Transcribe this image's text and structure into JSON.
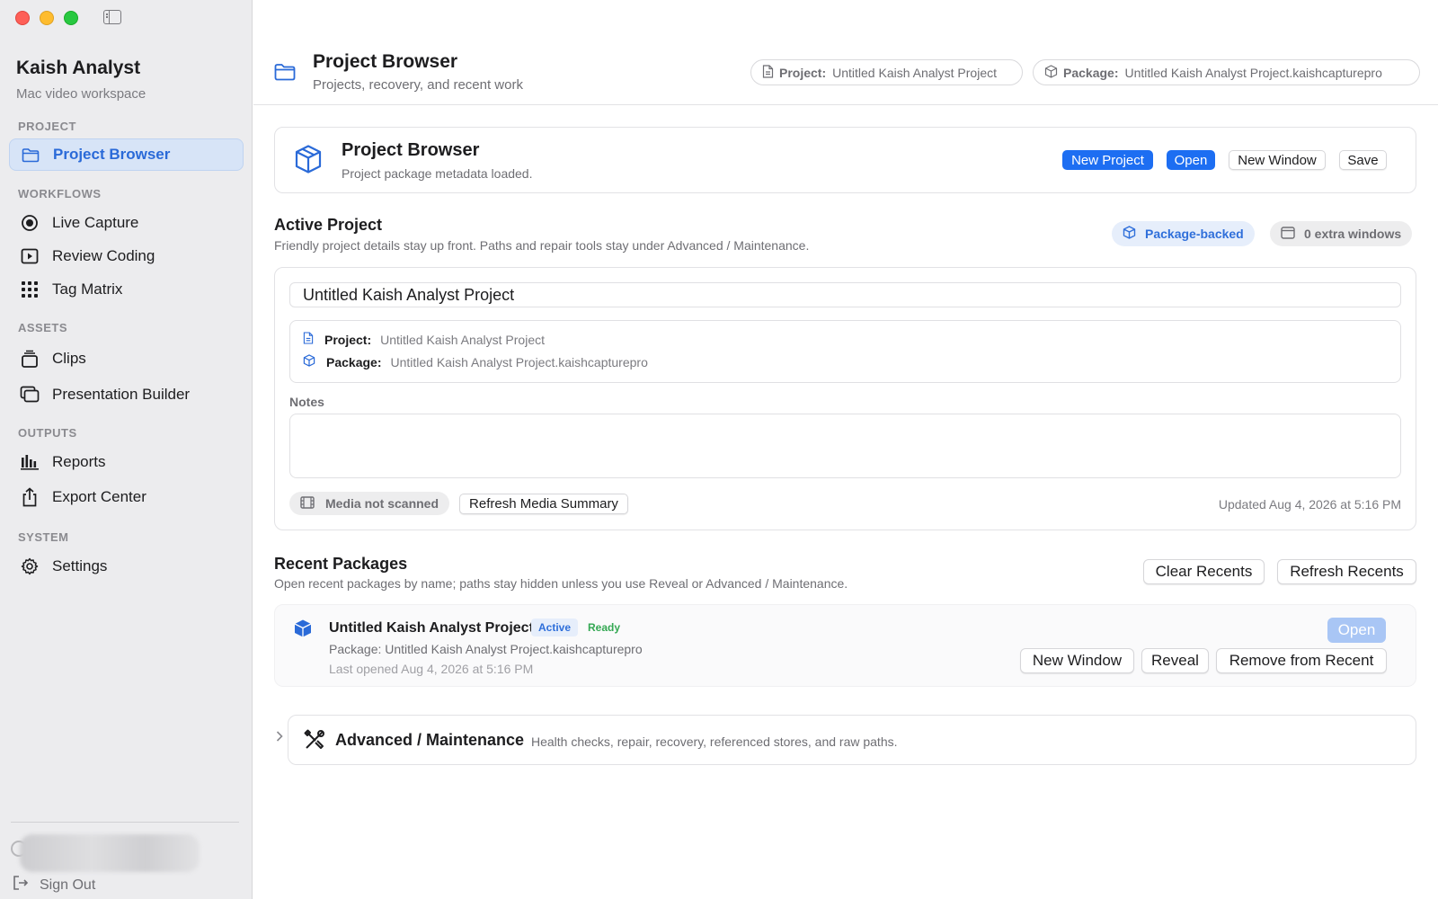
{
  "app": {
    "title": "Kaish Analyst",
    "subtitle": "Mac video workspace"
  },
  "sidebar": {
    "sections": [
      {
        "label": "PROJECT"
      },
      {
        "label": "WORKFLOWS"
      },
      {
        "label": "ASSETS"
      },
      {
        "label": "OUTPUTS"
      },
      {
        "label": "SYSTEM"
      }
    ],
    "items": [
      {
        "label": "Project Browser",
        "icon": "folder-icon",
        "active": true
      },
      {
        "label": "Live Capture",
        "icon": "record-icon"
      },
      {
        "label": "Review Coding",
        "icon": "play-icon"
      },
      {
        "label": "Tag Matrix",
        "icon": "grid-icon"
      },
      {
        "label": "Clips",
        "icon": "stack-icon"
      },
      {
        "label": "Presentation Builder",
        "icon": "slides-icon"
      },
      {
        "label": "Reports",
        "icon": "bar-chart-icon"
      },
      {
        "label": "Export Center",
        "icon": "share-icon"
      },
      {
        "label": "Settings",
        "icon": "gear-icon"
      }
    ],
    "sign_out": "Sign Out"
  },
  "header": {
    "title": "Project Browser",
    "subtitle": "Projects, recovery, and recent work",
    "project_label": "Project:",
    "project_value": "Untitled Kaish Analyst Project",
    "package_label": "Package:",
    "package_value": "Untitled Kaish Analyst Project.kaishcapturepro"
  },
  "browser_card": {
    "title": "Project Browser",
    "status": "Project package metadata loaded.",
    "buttons": {
      "new_project": "New Project",
      "open": "Open",
      "new_window": "New Window",
      "save": "Save"
    }
  },
  "active_project": {
    "title": "Active Project",
    "subtitle": "Friendly project details stay up front. Paths and repair tools stay under Advanced / Maintenance.",
    "chip_package": "Package-backed",
    "chip_windows": "0 extra windows",
    "name_value": "Untitled Kaish Analyst Project",
    "project_label": "Project:",
    "project_value": "Untitled Kaish Analyst Project",
    "package_label": "Package:",
    "package_value": "Untitled Kaish Analyst Project.kaishcapturepro",
    "notes_label": "Notes",
    "notes_value": "",
    "media_status": "Media not scanned",
    "refresh_media": "Refresh Media Summary",
    "updated": "Updated Aug 4, 2026 at 5:16 PM"
  },
  "recent": {
    "title": "Recent Packages",
    "subtitle": "Open recent packages by name; paths stay hidden unless you use Reveal or Advanced / Maintenance.",
    "clear": "Clear Recents",
    "refresh": "Refresh Recents",
    "items": [
      {
        "name": "Untitled Kaish Analyst Project",
        "badge_active": "Active",
        "badge_ready": "Ready",
        "package": "Package: Untitled Kaish Analyst Project.kaishcapturepro",
        "last_opened": "Last opened Aug 4, 2026 at 5:16 PM",
        "open": "Open",
        "new_window": "New Window",
        "reveal": "Reveal",
        "remove": "Remove from Recent"
      }
    ]
  },
  "advanced": {
    "title": "Advanced / Maintenance",
    "subtitle": "Health checks, repair, recovery, referenced stores, and raw paths."
  },
  "colors": {
    "accent": "#1d6ef2",
    "sidebar_bg": "#ececee",
    "active_item_bg": "#d7e4f7",
    "ready": "#34a853"
  }
}
